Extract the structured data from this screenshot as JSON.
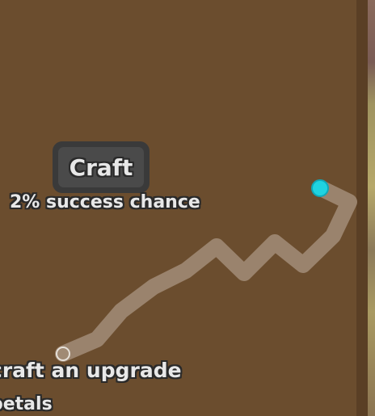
{
  "craft": {
    "button_label": "Craft",
    "chance_text": "2% success chance"
  },
  "hint": {
    "upgrade_text": "craft an upgrade",
    "petals_text": "petals"
  },
  "colors": {
    "panel": "#6b4d2e",
    "trail": "#a08a74",
    "cursor": "#1fd3e0",
    "button_outer": "#3a3a3a",
    "button_inner": "#4a4a4a"
  },
  "icons": {
    "cursor": "cyan-dot-cursor-icon",
    "trail_start": "ring-marker-icon"
  }
}
